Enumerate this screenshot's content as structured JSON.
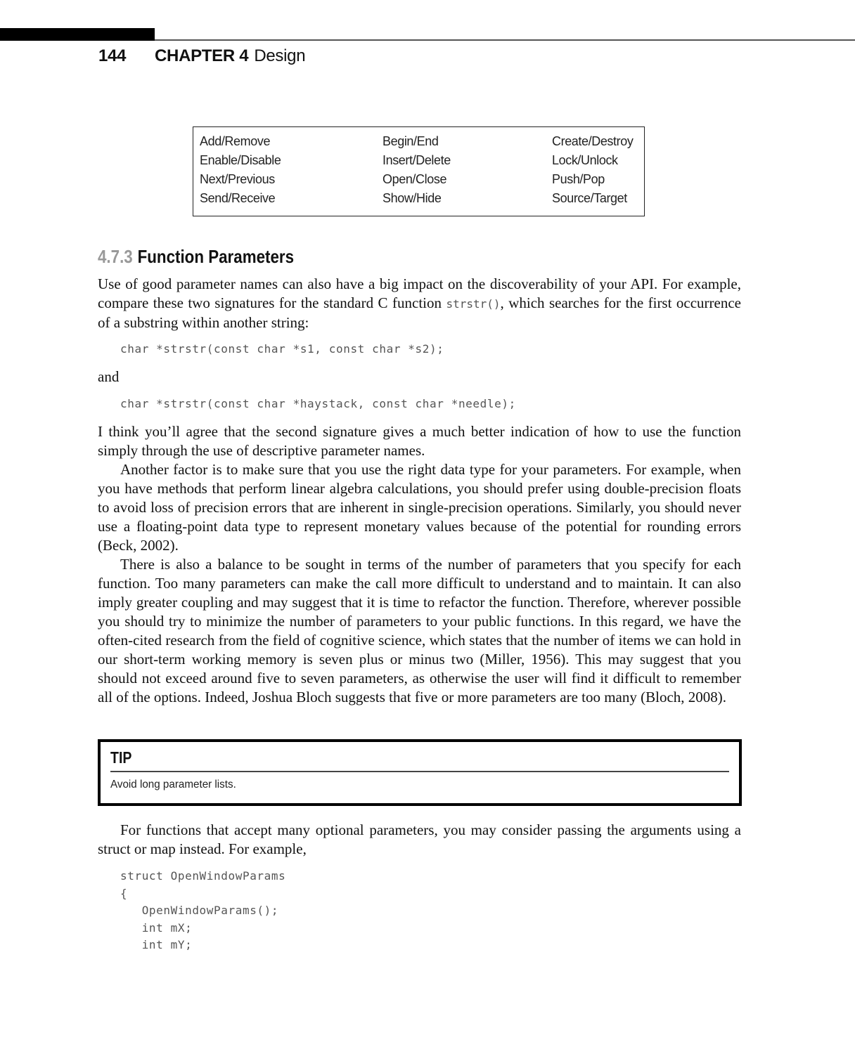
{
  "header": {
    "page_number": "144",
    "chapter_label": "CHAPTER 4",
    "chapter_title": "Design"
  },
  "pairs_table": {
    "rows": [
      [
        "Add/Remove",
        "Begin/End",
        "Create/Destroy"
      ],
      [
        "Enable/Disable",
        "Insert/Delete",
        "Lock/Unlock"
      ],
      [
        "Next/Previous",
        "Open/Close",
        "Push/Pop"
      ],
      [
        "Send/Receive",
        "Show/Hide",
        "Source/Target"
      ]
    ]
  },
  "section": {
    "number": "4.7.3",
    "title": "Function Parameters"
  },
  "intro": {
    "text_before_code": "Use of good parameter names can also have a big impact on the discoverability of your API. For example, compare these two signatures for the standard C function ",
    "inline_code": "strstr()",
    "text_after_code": ", which searches for the first occurrence of a substring within another string:"
  },
  "code_sig1": "char *strstr(const char *s1, const char *s2);",
  "connector": "and",
  "code_sig2": "char *strstr(const char *haystack, const char *needle);",
  "paragraphs": [
    "I think you’ll agree that the second signature gives a much better indication of how to use the function simply through the use of descriptive parameter names.",
    "Another factor is to make sure that you use the right data type for your parameters. For example, when you have methods that perform linear algebra calculations, you should prefer using double-precision floats to avoid loss of precision errors that are inherent in single-precision operations. Similarly, you should never use a floating-point data type to represent monetary values because of the potential for rounding errors (Beck, 2002).",
    "There is also a balance to be sought in terms of the number of parameters that you specify for each function. Too many parameters can make the call more difficult to understand and to maintain. It can also imply greater coupling and may suggest that it is time to refactor the function. Therefore, wherever possible you should try to minimize the number of parameters to your public functions. In this regard, we have the often-cited research from the field of cognitive science, which states that the number of items we can hold in our short-term working memory is seven plus or minus two (Miller, 1956). This may suggest that you should not exceed around five to seven parameters, as otherwise the user will find it difficult to remember all of the options. Indeed, Joshua Bloch suggests that five or more parameters are too many (Bloch, 2008)."
  ],
  "tip": {
    "title": "TIP",
    "text": "Avoid long parameter lists."
  },
  "after_tip": "For functions that accept many optional parameters, you may consider passing the arguments using a struct or map instead. For example,",
  "code_struct": [
    "struct OpenWindowParams",
    "{",
    "   OpenWindowParams();",
    "   int mX;",
    "   int mY;"
  ]
}
